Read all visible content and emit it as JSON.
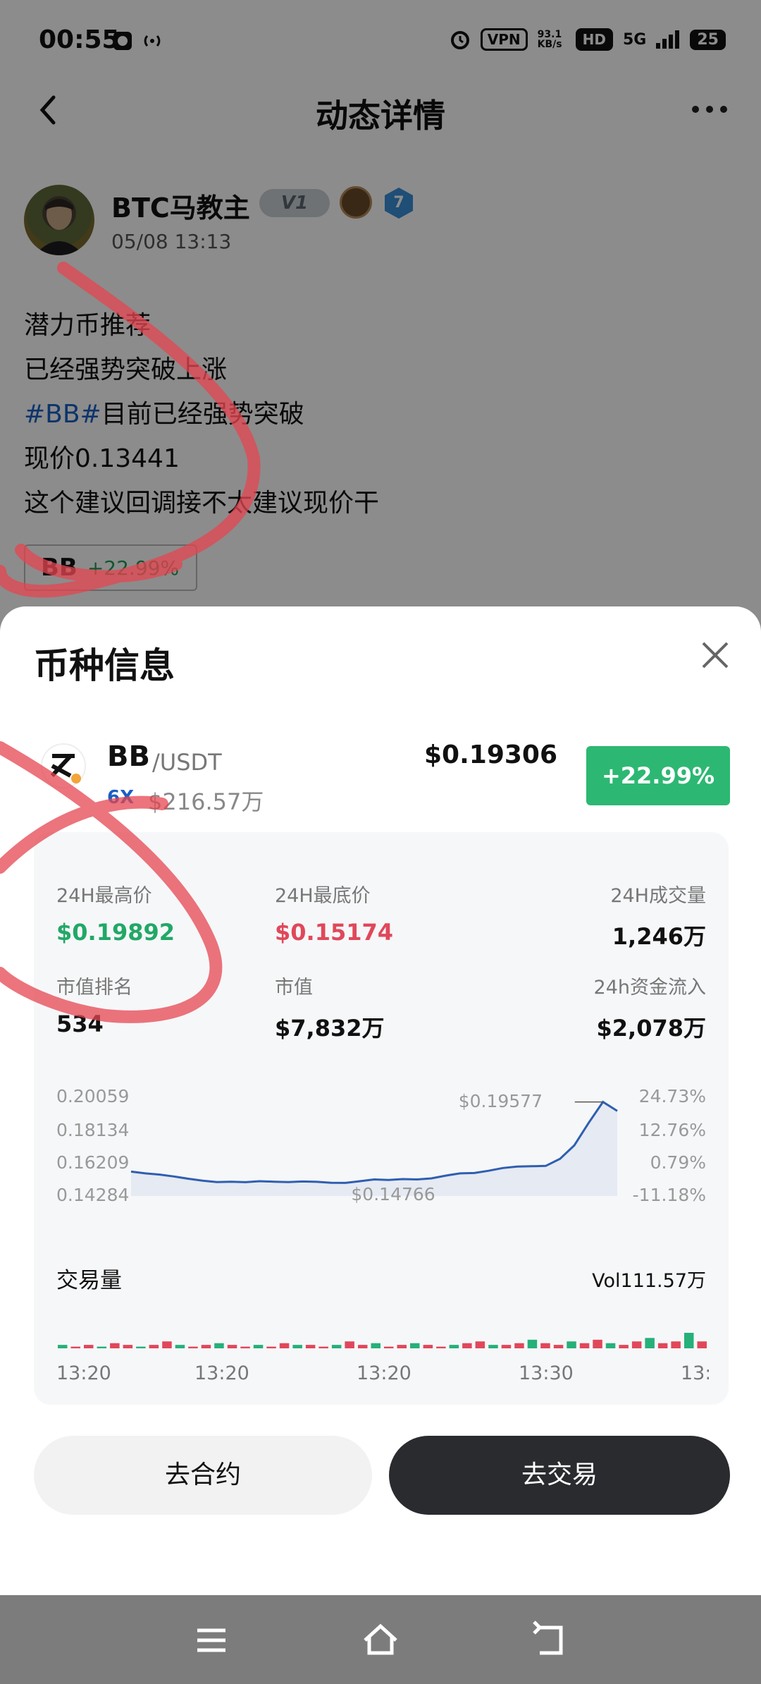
{
  "status_bar": {
    "time": "00:55",
    "vpn": "VPN",
    "speed": "93.1 KB/s",
    "hd": "HD",
    "signal": "5G",
    "battery": "25"
  },
  "header": {
    "title": "动态详情"
  },
  "post": {
    "author": "BTC马教主",
    "badge_level_text": "V1",
    "badge_rank": "7",
    "timestamp": "05/08 13:13",
    "lines": [
      "潜力币推荐",
      "已经强势突破上涨",
      "目前已经强势突破",
      "现价0.13441",
      "这个建议回调接不太建议现价干"
    ],
    "hashtag": "#BB#",
    "coin_tag": {
      "symbol": "BB",
      "change": "+22.99%"
    }
  },
  "sheet": {
    "title": "币种信息",
    "coin": {
      "symbol": "BB",
      "pair": "/USDT",
      "leverage": "6X",
      "volume": "$216.57万",
      "price": "$0.19306",
      "change": "+22.99%"
    },
    "stats": {
      "high_label": "24H最高价",
      "high_value": "$0.19892",
      "low_label": "24H最底价",
      "low_value": "$0.15174",
      "volume_label": "24H成交量",
      "volume_value": "1,246万",
      "rank_label": "市值排名",
      "rank_value": "534",
      "cap_label": "市值",
      "cap_value": "$7,832万",
      "inflow_label": "24h资金流入",
      "inflow_value": "$2,078万"
    },
    "volume_section": {
      "title": "交易量",
      "total": "Vol111.57万"
    },
    "buttons": {
      "contract": "去合约",
      "trade": "去交易"
    }
  },
  "chart_data": {
    "type": "line",
    "y_axis_left": [
      "0.20059",
      "0.18134",
      "0.16209",
      "0.14284"
    ],
    "y_axis_right": [
      "24.73%",
      "12.76%",
      "0.79%",
      "-11.18%"
    ],
    "ylim": [
      0.14284,
      0.20059
    ],
    "x_ticks": [
      "13:20",
      "13:20",
      "13:20",
      "13:30",
      "13:"
    ],
    "annotation_high": "$0.19577",
    "annotation_low": "$0.14766",
    "series": [
      {
        "values": [
          0.1569,
          0.1559,
          0.1552,
          0.1541,
          0.1528,
          0.1517,
          0.1509,
          0.1511,
          0.1508,
          0.1514,
          0.1511,
          0.1509,
          0.1512,
          0.151,
          0.1505,
          0.1504,
          0.1514,
          0.1524,
          0.1521,
          0.1526,
          0.1524,
          0.153,
          0.1546,
          0.1559,
          0.1561,
          0.1574,
          0.159,
          0.1598,
          0.16,
          0.1602,
          0.1643,
          0.1721,
          0.185,
          0.1971,
          0.1919
        ],
        "color": "#2f5fb0"
      }
    ],
    "volume_bars": [
      2,
      1,
      2,
      1,
      3,
      2,
      1,
      2,
      4,
      2,
      1,
      2,
      3,
      2,
      1,
      2,
      1,
      3,
      2,
      2,
      1,
      2,
      4,
      2,
      3,
      1,
      2,
      3,
      2,
      1,
      2,
      3,
      4,
      2,
      2,
      3,
      5,
      3,
      2,
      4,
      3,
      5,
      3,
      2,
      4,
      6,
      3,
      4,
      9,
      4
    ],
    "volume_up_color": "#27b079",
    "volume_down_color": "#e0485a"
  }
}
